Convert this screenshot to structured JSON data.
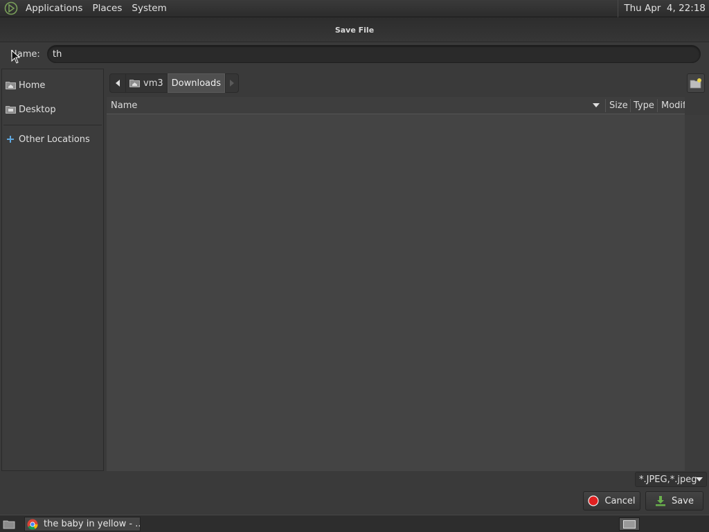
{
  "top_panel": {
    "menus": [
      "Applications",
      "Places",
      "System"
    ],
    "clock": "Thu Apr  4, 22:18"
  },
  "dialog": {
    "title": "Save File",
    "name_label": "Name:",
    "name_value": "th",
    "sidebar": [
      {
        "label": "Home",
        "icon": "home-folder-icon"
      },
      {
        "label": "Desktop",
        "icon": "desktop-folder-icon"
      },
      {
        "label": "Other Locations",
        "icon": "plus-icon"
      }
    ],
    "path": [
      "vm3",
      "Downloads"
    ],
    "columns": {
      "name": "Name",
      "size": "Size",
      "type": "Type",
      "modified": "Modified"
    },
    "filter": "*.JPEG,*.jpeg",
    "cancel_label": "Cancel",
    "save_label": "Save"
  },
  "taskbar": {
    "window_title": "the baby in yellow - ..."
  },
  "colors": {
    "cancel_icon": "#e02020",
    "save_icon": "#6ab04c",
    "folder_icon": "#9a9a9a"
  }
}
